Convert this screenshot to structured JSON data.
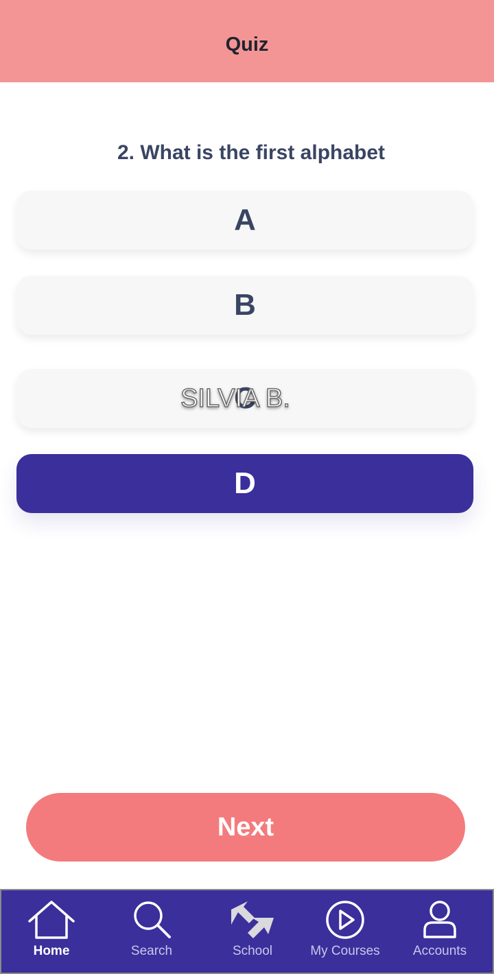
{
  "header": {
    "title": "Quiz"
  },
  "question": {
    "text": "2. What is the first alphabet"
  },
  "options": [
    {
      "label": "A",
      "selected": false
    },
    {
      "label": "B",
      "selected": false
    },
    {
      "label": "C",
      "selected": false
    },
    {
      "label": "D",
      "selected": true
    }
  ],
  "watermark": {
    "text": "SILVIA B."
  },
  "next_button": {
    "label": "Next"
  },
  "tabbar": {
    "items": [
      {
        "label": "Home",
        "icon": "home-icon",
        "active": true
      },
      {
        "label": "Search",
        "icon": "search-icon",
        "active": false
      },
      {
        "label": "School",
        "icon": "school-icon",
        "active": false
      },
      {
        "label": "My Courses",
        "icon": "play-circle-icon",
        "active": false
      },
      {
        "label": "Accounts",
        "icon": "user-icon",
        "active": false
      }
    ]
  },
  "colors": {
    "header": "#f49595",
    "selected_option": "#3b2f9b",
    "next_button": "#f37b7d",
    "tabbar": "#3b2f9b"
  }
}
